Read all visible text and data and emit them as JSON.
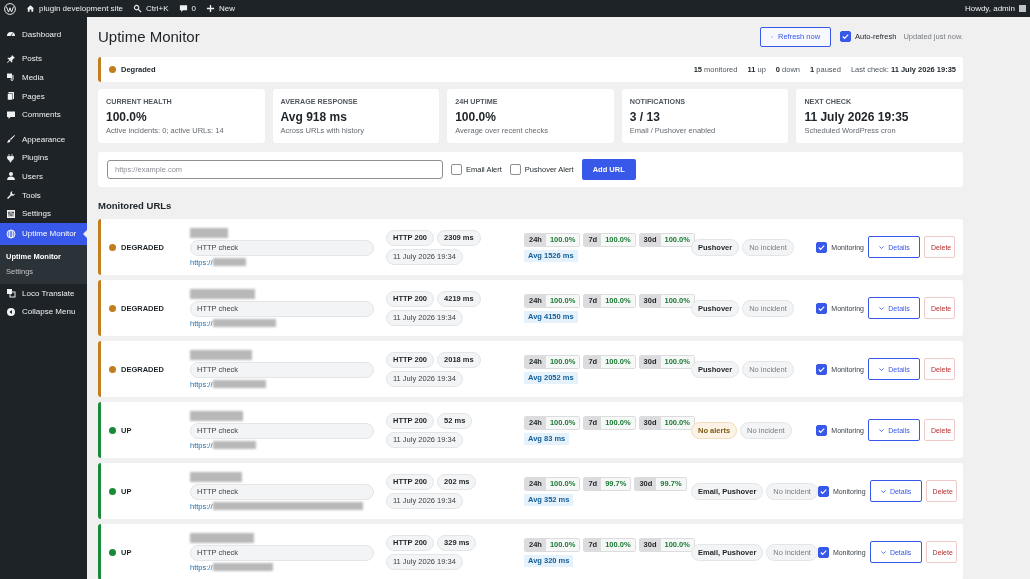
{
  "admin_bar": {
    "site_name": "plugin development site",
    "search_shortcut": "Ctrl+K",
    "comments_count": "0",
    "new_label": "New",
    "greeting": "Howdy, admin"
  },
  "sidebar": {
    "items": [
      {
        "label": "Dashboard",
        "selected": false
      },
      {
        "label": "Posts",
        "selected": false
      },
      {
        "label": "Media",
        "selected": false
      },
      {
        "label": "Pages",
        "selected": false
      },
      {
        "label": "Comments",
        "selected": false
      },
      {
        "label": "Appearance",
        "selected": false
      },
      {
        "label": "Plugins",
        "selected": false
      },
      {
        "label": "Users",
        "selected": false
      },
      {
        "label": "Tools",
        "selected": false
      },
      {
        "label": "Settings",
        "selected": false
      },
      {
        "label": "Uptime Monitor",
        "selected": true,
        "children": [
          {
            "label": "Uptime Monitor",
            "selected": true
          },
          {
            "label": "Settings",
            "selected": false
          }
        ]
      },
      {
        "label": "Loco Translate",
        "selected": false
      },
      {
        "label": "Collapse Menu",
        "selected": false
      }
    ]
  },
  "header": {
    "title": "Uptime Monitor",
    "refresh_button": "Refresh now",
    "auto_refresh": {
      "label": "Auto-refresh",
      "checked": true
    },
    "updated_text": "Updated just now."
  },
  "status_banner": {
    "status": "Degraded",
    "color": "#c27d1e",
    "counts": [
      "**15** monitored",
      "**11** up",
      "**0** down",
      "**1** paused"
    ],
    "last_check": "Last check: **11 July 2026 19:35**"
  },
  "stats": [
    {
      "label": "CURRENT HEALTH",
      "value": "100.0%",
      "note": "Active incidents: 0; active URLs: 14"
    },
    {
      "label": "AVERAGE RESPONSE",
      "value": "Avg 918 ms",
      "note": "Across URLs with history"
    },
    {
      "label": "24H UPTIME",
      "value": "100.0%",
      "note": "Average over recent checks"
    },
    {
      "label": "NOTIFICATIONS",
      "value": "3 / 13",
      "note": "Email / Pushover enabled"
    },
    {
      "label": "NEXT CHECK",
      "value": "11 July 2026 19:35",
      "note": "Scheduled WordPress cron"
    }
  ],
  "add_form": {
    "placeholder": "https://example.com",
    "email_alert": {
      "label": "Email Alert",
      "checked": false
    },
    "pushover_alert": {
      "label": "Pushover Alert",
      "checked": false
    },
    "button": "Add URL"
  },
  "section_title": "Monitored URLs",
  "monitors": [
    {
      "status": "DEGRADED",
      "color": "#c27d1e",
      "check_type": "HTTP check",
      "url_prefix": "https://",
      "http_code": "HTTP 200",
      "response": "2309 ms",
      "checked_at": "11 July 2026 19:34",
      "uptime": [
        {
          "period": "24h",
          "value": "100.0%"
        },
        {
          "period": "7d",
          "value": "100.0%"
        },
        {
          "period": "30d",
          "value": "100.0%"
        }
      ],
      "avg": "Avg 1526 ms",
      "alerts": {
        "label": "Pushover",
        "kind": "enabled"
      },
      "incident": "No incident",
      "monitoring": {
        "label": "Monitoring",
        "checked": true
      },
      "details": "Details",
      "delete": "Delete"
    },
    {
      "status": "DEGRADED",
      "color": "#c27d1e",
      "check_type": "HTTP check",
      "url_prefix": "https://",
      "http_code": "HTTP 200",
      "response": "4219 ms",
      "checked_at": "11 July 2026 19:34",
      "uptime": [
        {
          "period": "24h",
          "value": "100.0%"
        },
        {
          "period": "7d",
          "value": "100.0%"
        },
        {
          "period": "30d",
          "value": "100.0%"
        }
      ],
      "avg": "Avg 4150 ms",
      "alerts": {
        "label": "Pushover",
        "kind": "enabled"
      },
      "incident": "No incident",
      "monitoring": {
        "label": "Monitoring",
        "checked": true
      },
      "details": "Details",
      "delete": "Delete"
    },
    {
      "status": "DEGRADED",
      "color": "#c27d1e",
      "check_type": "HTTP check",
      "url_prefix": "https://",
      "http_code": "HTTP 200",
      "response": "2018 ms",
      "checked_at": "11 July 2026 19:34",
      "uptime": [
        {
          "period": "24h",
          "value": "100.0%"
        },
        {
          "period": "7d",
          "value": "100.0%"
        },
        {
          "period": "30d",
          "value": "100.0%"
        }
      ],
      "avg": "Avg 2052 ms",
      "alerts": {
        "label": "Pushover",
        "kind": "enabled"
      },
      "incident": "No incident",
      "monitoring": {
        "label": "Monitoring",
        "checked": true
      },
      "details": "Details",
      "delete": "Delete"
    },
    {
      "status": "UP",
      "color": "#1a8a3a",
      "check_type": "HTTP check",
      "url_prefix": "https://",
      "http_code": "HTTP 200",
      "response": "52 ms",
      "checked_at": "11 July 2026 19:34",
      "uptime": [
        {
          "period": "24h",
          "value": "100.0%"
        },
        {
          "period": "7d",
          "value": "100.0%"
        },
        {
          "period": "30d",
          "value": "100.0%"
        }
      ],
      "avg": "Avg 83 ms",
      "alerts": {
        "label": "No alerts",
        "kind": "none"
      },
      "incident": "No incident",
      "monitoring": {
        "label": "Monitoring",
        "checked": true
      },
      "details": "Details",
      "delete": "Delete"
    },
    {
      "status": "UP",
      "color": "#1a8a3a",
      "check_type": "HTTP check",
      "url_prefix": "https://",
      "http_code": "HTTP 200",
      "response": "202 ms",
      "checked_at": "11 July 2026 19:34",
      "uptime": [
        {
          "period": "24h",
          "value": "100.0%"
        },
        {
          "period": "7d",
          "value": "99.7%"
        },
        {
          "period": "30d",
          "value": "99.7%"
        }
      ],
      "avg": "Avg 352 ms",
      "alerts": {
        "label": "Email, Pushover",
        "kind": "enabled"
      },
      "incident": "No incident",
      "monitoring": {
        "label": "Monitoring",
        "checked": true
      },
      "details": "Details",
      "delete": "Delete"
    },
    {
      "status": "UP",
      "color": "#1a8a3a",
      "check_type": "HTTP check",
      "url_prefix": "https://",
      "http_code": "HTTP 200",
      "response": "329 ms",
      "checked_at": "11 July 2026 19:34",
      "uptime": [
        {
          "period": "24h",
          "value": "100.0%"
        },
        {
          "period": "7d",
          "value": "100.0%"
        },
        {
          "period": "30d",
          "value": "100.0%"
        }
      ],
      "avg": "Avg 320 ms",
      "alerts": {
        "label": "Email, Pushover",
        "kind": "enabled"
      },
      "incident": "No incident",
      "monitoring": {
        "label": "Monitoring",
        "checked": true
      },
      "details": "Details",
      "delete": "Delete"
    }
  ]
}
